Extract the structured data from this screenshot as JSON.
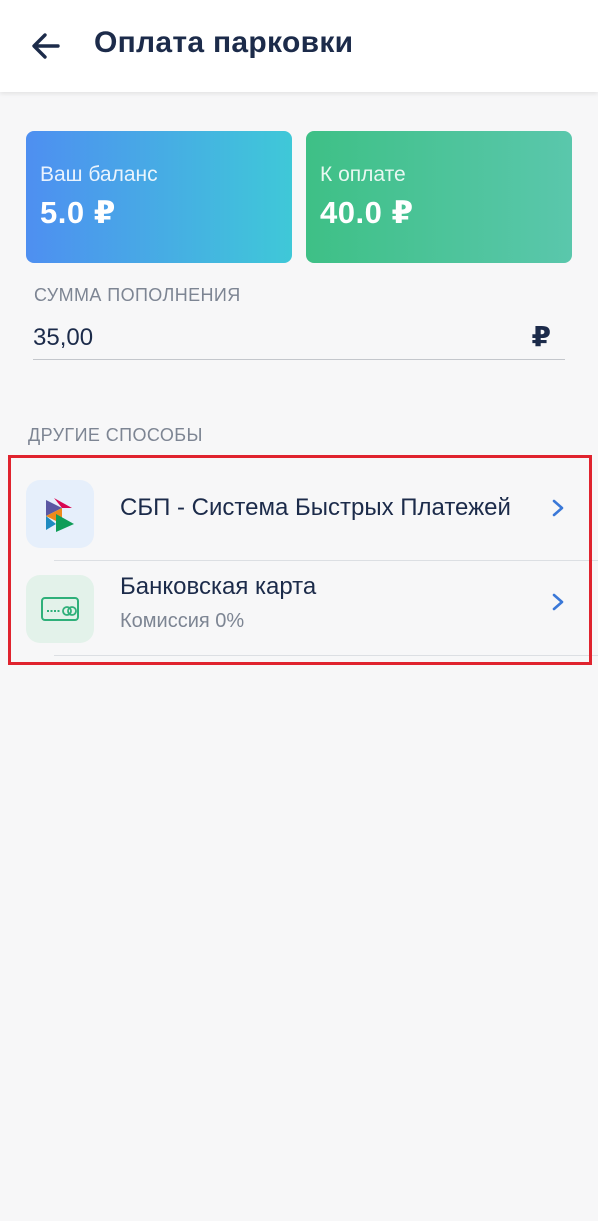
{
  "header": {
    "title": "Оплата парковки",
    "back_icon": "arrow-left-icon"
  },
  "balance_card": {
    "label": "Ваш баланс",
    "value": "5.0 ₽",
    "gradient": [
      "#4e8ff1",
      "#3fc8d8"
    ]
  },
  "due_card": {
    "label": "К оплате",
    "value": "40.0 ₽",
    "gradient": [
      "#3ec086",
      "#5ac7ac"
    ]
  },
  "topup": {
    "label": "СУММА ПОПОЛНЕНИЯ",
    "value": "35,00",
    "currency": "₽"
  },
  "other_methods": {
    "label": "ДРУГИЕ СПОСОБЫ",
    "items": [
      {
        "title": "СБП - Система Быстрых Платежей",
        "icon": "sbp-logo-icon"
      },
      {
        "title": "Банковская карта",
        "subtitle": "Комиссия 0%",
        "icon": "bank-card-icon"
      }
    ]
  },
  "colors": {
    "text_primary": "#1c2b4a",
    "text_secondary": "#7d8593",
    "accent": "#3a78d8",
    "highlight": "#e0232e"
  }
}
